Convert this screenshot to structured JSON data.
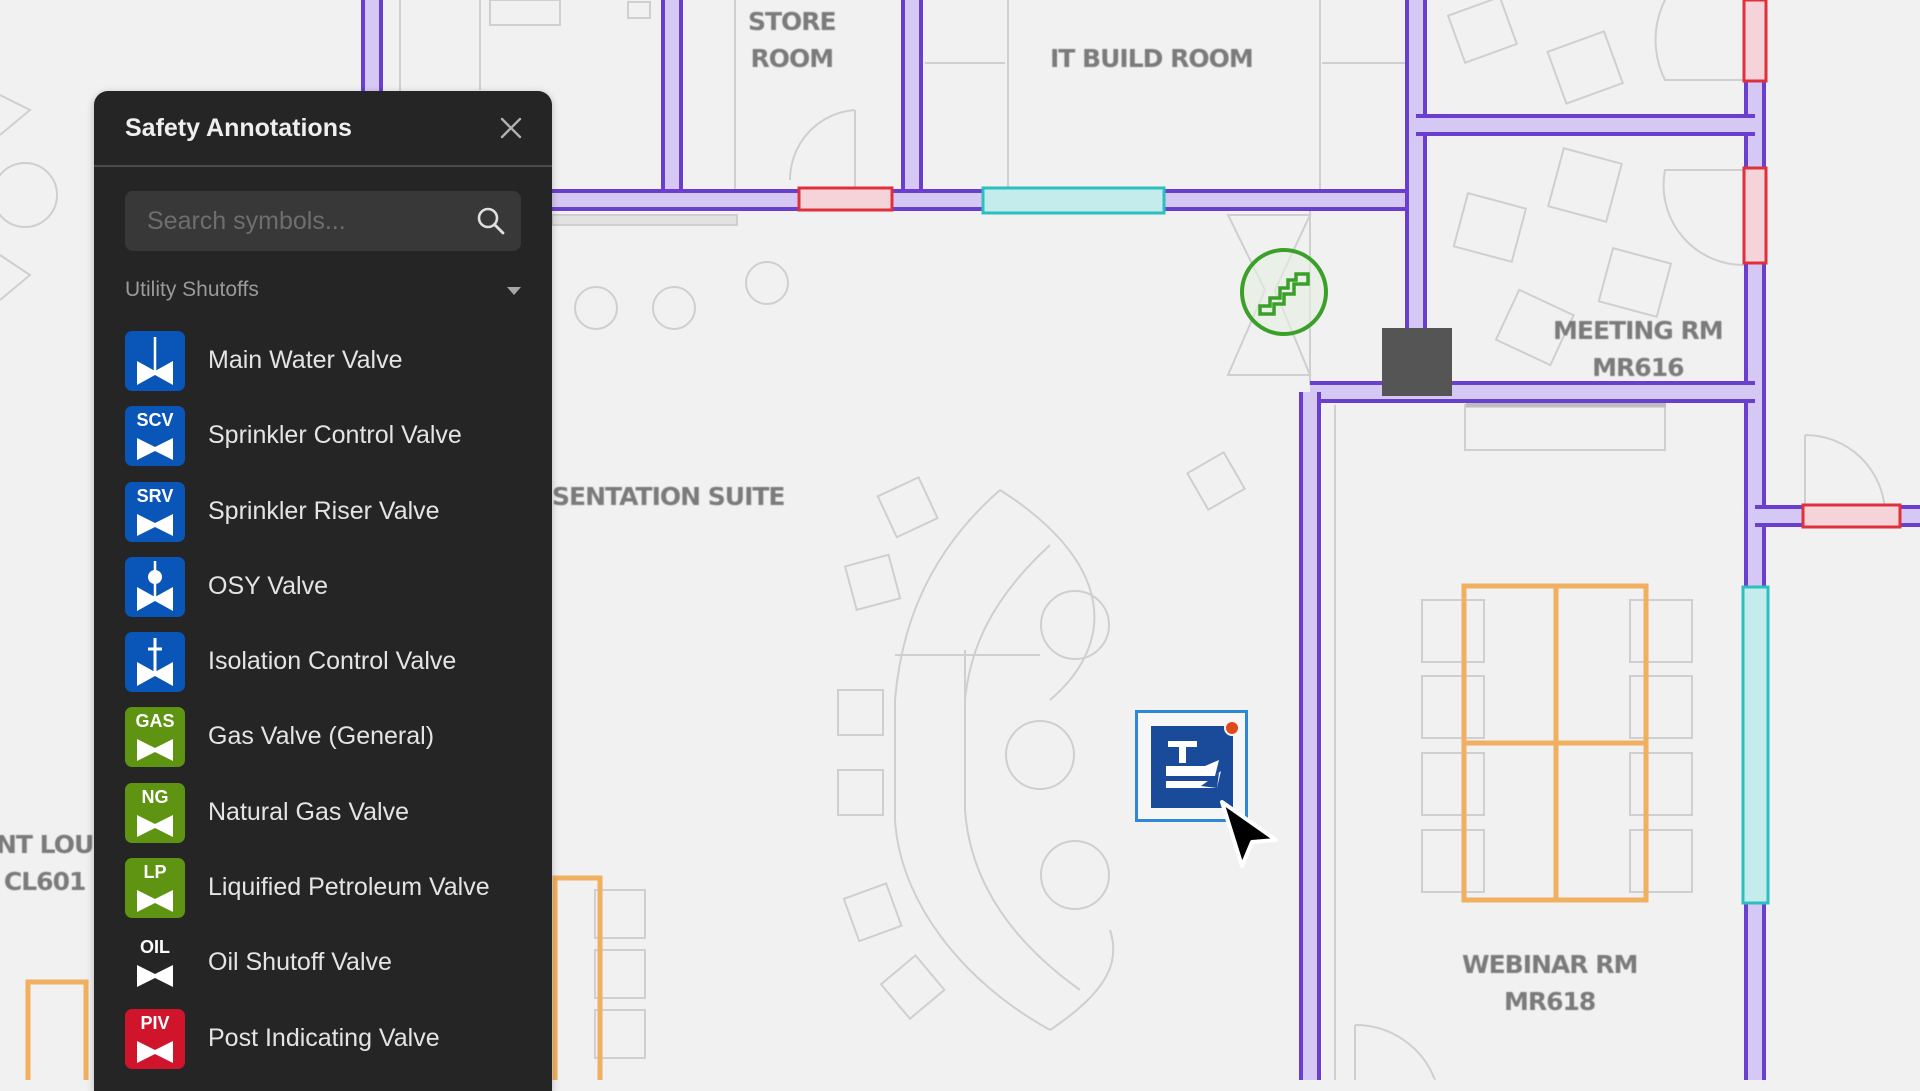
{
  "panel": {
    "title": "Safety Annotations",
    "close_icon": "close-icon",
    "search": {
      "placeholder": "Search symbols...",
      "value": "",
      "icon": "search-icon"
    },
    "section": {
      "label": "Utility Shutoffs",
      "icon": "chevron-down-icon"
    },
    "items": [
      {
        "label": "Main Water Valve",
        "abbr": "",
        "glyph": "stem",
        "color": "#0a55b8"
      },
      {
        "label": "Sprinkler Control Valve",
        "abbr": "SCV",
        "glyph": "abbr",
        "color": "#0a55b8"
      },
      {
        "label": "Sprinkler Riser Valve",
        "abbr": "SRV",
        "glyph": "abbr",
        "color": "#0a55b8"
      },
      {
        "label": "OSY Valve",
        "abbr": "",
        "glyph": "osy",
        "color": "#0a55b8"
      },
      {
        "label": "Isolation Control Valve",
        "abbr": "",
        "glyph": "cross",
        "color": "#0a55b8"
      },
      {
        "label": "Gas Valve (General)",
        "abbr": "GAS",
        "glyph": "abbr",
        "color": "#5e9412"
      },
      {
        "label": "Natural Gas Valve",
        "abbr": "NG",
        "glyph": "abbr",
        "color": "#5e9412"
      },
      {
        "label": "Liquified Petroleum Valve",
        "abbr": "LP",
        "glyph": "abbr",
        "color": "#5e9412"
      },
      {
        "label": "Oil Shutoff Valve",
        "abbr": "OIL",
        "glyph": "abbr",
        "color": "#252525"
      },
      {
        "label": "Post Indicating Valve",
        "abbr": "PIV",
        "glyph": "abbr",
        "color": "#d0142c"
      }
    ]
  },
  "floorplan": {
    "rooms": [
      {
        "name": "store-room",
        "label": "STORE\nROOM"
      },
      {
        "name": "it-build-room",
        "label": "IT BUILD ROOM"
      },
      {
        "name": "meeting-room",
        "label": "MEETING RM\nMR616"
      },
      {
        "name": "presentation-suite",
        "label": "SENTATION SUITE"
      },
      {
        "name": "webinar-room",
        "label": "WEBINAR RM\nMR618"
      },
      {
        "name": "client-lounge",
        "label": "NT LOU\nCL601"
      }
    ],
    "markers": {
      "stairs": {
        "icon": "stairs-icon",
        "color": "#3aa02a"
      },
      "cctv": {
        "icon": "security-camera-icon",
        "color": "#1a4a9a",
        "status_dot": "#e04a1a"
      }
    },
    "colors": {
      "wall": "#6a3fd0",
      "wall_fill": "#d6c8f4",
      "door_red": "#e0303c",
      "door_red_fill": "#f4d4d8",
      "window_teal": "#2ac0c0",
      "window_teal_fill": "#c4ecec",
      "furniture_orange": "#f0b060"
    }
  },
  "cursor": {
    "icon": "mouse-pointer-icon"
  }
}
